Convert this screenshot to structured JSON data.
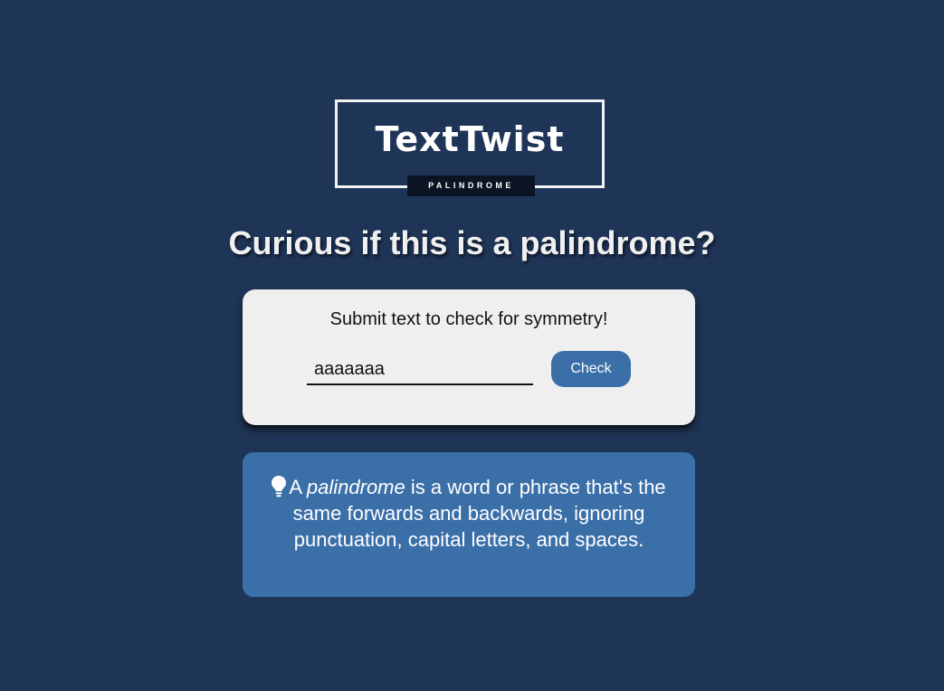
{
  "logo": {
    "title": "TextTwist",
    "subtitle": "PALINDROME"
  },
  "headline": "Curious if this is a palindrome?",
  "form": {
    "prompt": "Submit text to check for symmetry!",
    "input_value": "aaaaaaa",
    "button_label": "Check"
  },
  "info": {
    "icon": "lightbulb-icon",
    "lead": "A",
    "term": "palindrome",
    "body": "is a word or phrase that's the same forwards and backwards, ignoring punctuation, capital letters, and spaces."
  },
  "colors": {
    "background": "#1f3558",
    "accent": "#3b6fa8",
    "card": "#efefef"
  }
}
